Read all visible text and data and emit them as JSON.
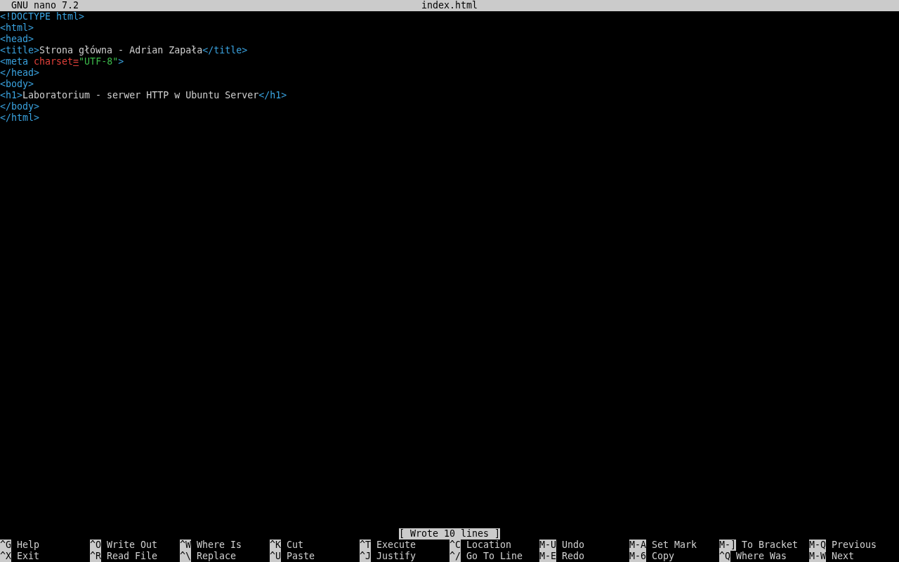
{
  "title_bar": {
    "app": "GNU nano 7.2",
    "file": "index.html"
  },
  "lines": [
    [
      {
        "kind": "tag",
        "text": "<!DOCTYPE html>"
      }
    ],
    [
      {
        "kind": "tag",
        "text": "<html>"
      }
    ],
    [
      {
        "kind": "tag",
        "text": "<head>"
      }
    ],
    [
      {
        "kind": "tag",
        "text": "<title>"
      },
      {
        "kind": "text",
        "text": "Strona główna - Adrian Zapała"
      },
      {
        "kind": "tag",
        "text": "</title>"
      }
    ],
    [
      {
        "kind": "tag",
        "text": "<meta "
      },
      {
        "kind": "attr",
        "text": "charset"
      },
      {
        "kind": "cursor",
        "text": "="
      },
      {
        "kind": "string",
        "text": "\"UTF-8\""
      },
      {
        "kind": "tag",
        "text": ">"
      }
    ],
    [
      {
        "kind": "tag",
        "text": "</head>"
      }
    ],
    [
      {
        "kind": "tag",
        "text": "<body>"
      }
    ],
    [
      {
        "kind": "tag",
        "text": "<h1>"
      },
      {
        "kind": "text",
        "text": "Laboratorium - serwer HTTP w Ubuntu Server"
      },
      {
        "kind": "tag",
        "text": "</h1>"
      }
    ],
    [
      {
        "kind": "tag",
        "text": "</body>"
      }
    ],
    [
      {
        "kind": "tag",
        "text": "</html>"
      }
    ]
  ],
  "status": "[ Wrote 10 lines ]",
  "shortcuts": [
    [
      {
        "key": "^G",
        "label": "Help"
      },
      {
        "key": "^O",
        "label": "Write Out"
      },
      {
        "key": "^W",
        "label": "Where Is"
      },
      {
        "key": "^K",
        "label": "Cut"
      },
      {
        "key": "^T",
        "label": "Execute"
      },
      {
        "key": "^C",
        "label": "Location"
      },
      {
        "key": "M-U",
        "label": "Undo"
      },
      {
        "key": "M-A",
        "label": "Set Mark"
      },
      {
        "key": "M-]",
        "label": "To Bracket"
      },
      {
        "key": "M-Q",
        "label": "Previous"
      }
    ],
    [
      {
        "key": "^X",
        "label": "Exit"
      },
      {
        "key": "^R",
        "label": "Read File"
      },
      {
        "key": "^\\",
        "label": "Replace"
      },
      {
        "key": "^U",
        "label": "Paste"
      },
      {
        "key": "^J",
        "label": "Justify"
      },
      {
        "key": "^/",
        "label": "Go To Line"
      },
      {
        "key": "M-E",
        "label": "Redo"
      },
      {
        "key": "M-6",
        "label": "Copy"
      },
      {
        "key": "^Q",
        "label": "Where Was"
      },
      {
        "key": "M-W",
        "label": "Next"
      }
    ]
  ]
}
